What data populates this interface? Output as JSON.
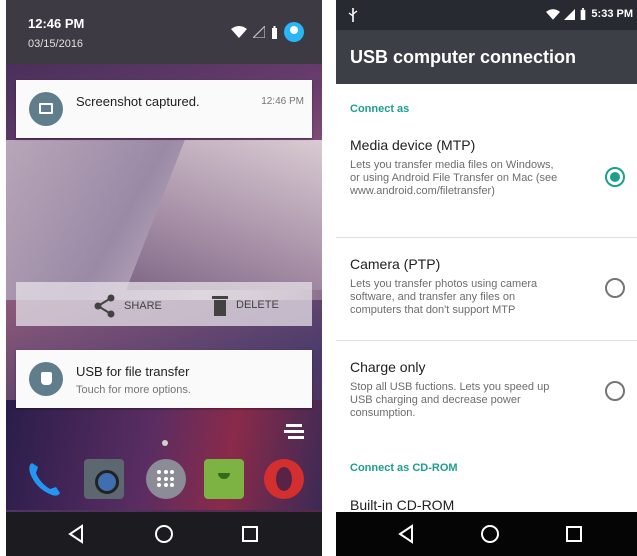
{
  "left": {
    "status": {
      "time": "12:46 PM",
      "date": "03/15/2016"
    },
    "screenshot_notification": {
      "title": "Screenshot captured.",
      "time": "12:46 PM"
    },
    "actions": {
      "share_label": "SHARE",
      "delete_label": "DELETE"
    },
    "usb_notification": {
      "title": "USB for file transfer",
      "subtitle": "Touch for more options."
    },
    "dock_apps": [
      "phone",
      "camera",
      "app-launcher",
      "messenger",
      "opera"
    ]
  },
  "right": {
    "status": {
      "time": "5:33 PM"
    },
    "app_bar_title": "USB computer connection",
    "sections": {
      "connect_as": "Connect as",
      "connect_as_cdrom": "Connect as CD-ROM"
    },
    "options": [
      {
        "title": "Media device (MTP)",
        "description": "Lets you transfer media files on Windows, or using Android File Transfer on Mac (see www.android.com/filetransfer)",
        "selected": true
      },
      {
        "title": "Camera (PTP)",
        "description": "Lets you transfer photos using camera software, and transfer any files on computers that don't support MTP",
        "selected": false
      },
      {
        "title": "Charge only",
        "description": "Stop all USB fuctions. Lets you speed up USB charging and decrease power consumption.",
        "selected": false
      }
    ],
    "cdrom_option": {
      "title": "Built-in CD-ROM"
    }
  },
  "colors": {
    "accent": "#1e9e8e",
    "app_bar": "#3c4046",
    "status_bar": "#272a30"
  },
  "icons": [
    "wifi-icon",
    "signal-icon",
    "battery-icon",
    "user-avatar-icon",
    "screenshot-icon",
    "share-icon",
    "trash-icon",
    "android-icon",
    "clear-all-icon",
    "back-icon",
    "home-icon",
    "recents-icon",
    "usb-icon"
  ]
}
